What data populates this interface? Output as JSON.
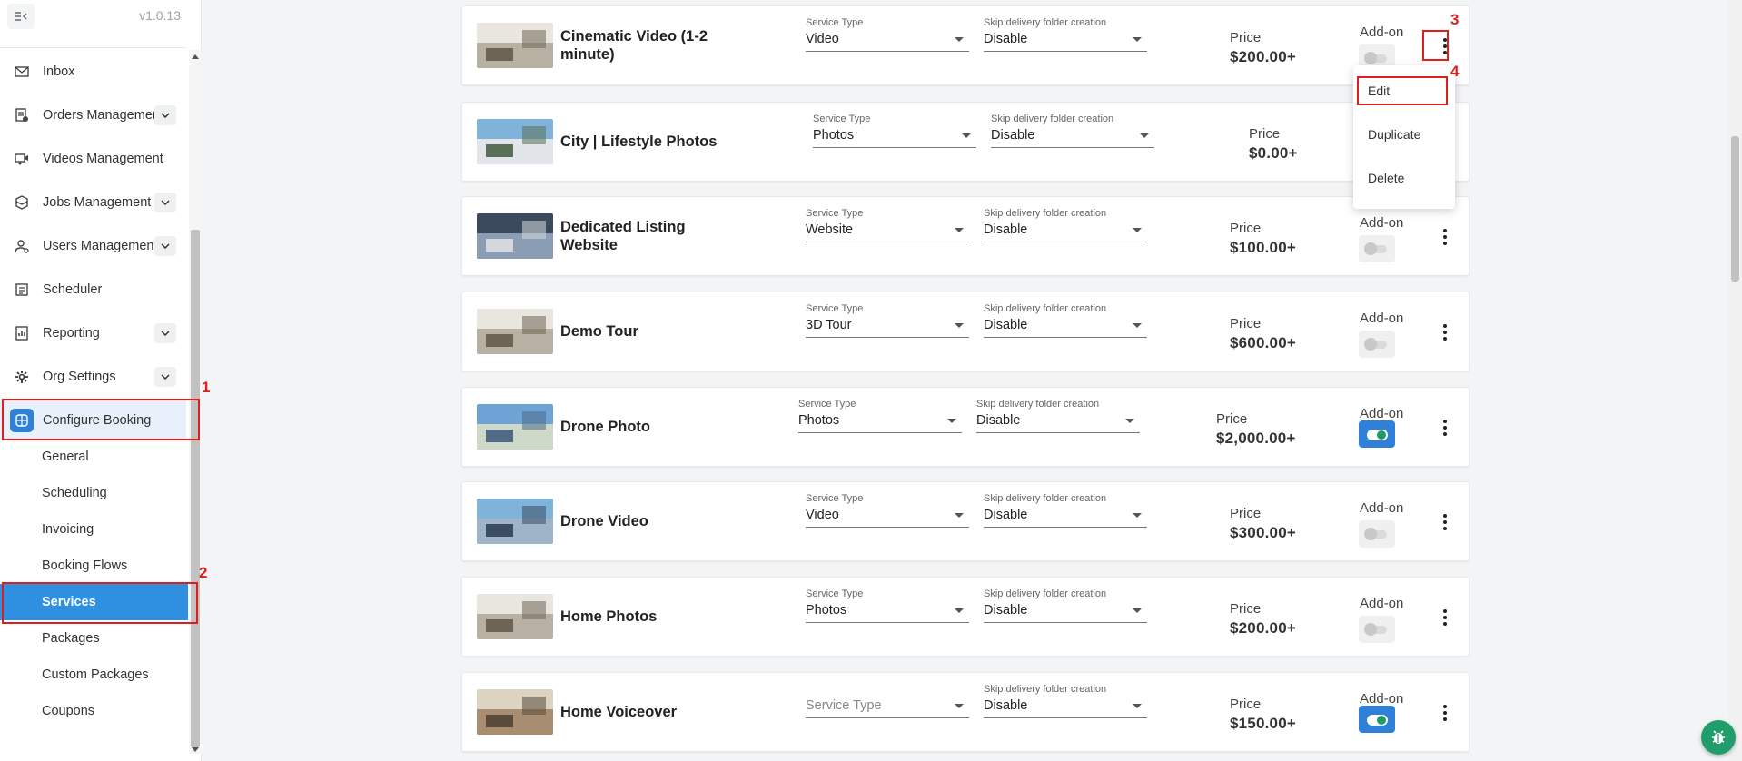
{
  "app": {
    "version": "v1.0.13"
  },
  "sidebar": {
    "items": [
      {
        "label": "Inbox",
        "icon": "mail-icon",
        "has_chevron": false
      },
      {
        "label": "Orders Management",
        "icon": "orders-icon",
        "has_chevron": true
      },
      {
        "label": "Videos Management",
        "icon": "video-icon",
        "has_chevron": false
      },
      {
        "label": "Jobs Management",
        "icon": "box-icon",
        "has_chevron": true
      },
      {
        "label": "Users Management",
        "icon": "users-icon",
        "has_chevron": true
      },
      {
        "label": "Scheduler",
        "icon": "calendar-icon",
        "has_chevron": false
      },
      {
        "label": "Reporting",
        "icon": "report-icon",
        "has_chevron": true
      },
      {
        "label": "Org Settings",
        "icon": "gear-icon",
        "has_chevron": true
      },
      {
        "label": "Configure Booking",
        "icon": "booking-icon",
        "has_chevron": false,
        "active": true
      }
    ],
    "sub_items": [
      "General",
      "Scheduling",
      "Invoicing",
      "Booking Flows",
      "Services",
      "Packages",
      "Custom Packages",
      "Coupons"
    ],
    "active_sub": "Services"
  },
  "labels": {
    "service_type": "Service Type",
    "skip_delivery": "Skip delivery folder creation",
    "price": "Price",
    "addon": "Add-on"
  },
  "services": [
    {
      "name": "Cinematic Video (1-2 minute)",
      "service_type": "Video",
      "skip_delivery": "Disable",
      "price": "$200.00+",
      "addon": false
    },
    {
      "name": "City | Lifestyle Photos",
      "service_type": "Photos",
      "skip_delivery": "Disable",
      "price": "$0.00+",
      "addon": null
    },
    {
      "name": "Dedicated Listing Website",
      "service_type": "Website",
      "skip_delivery": "Disable",
      "price": "$100.00+",
      "addon": false
    },
    {
      "name": "Demo Tour",
      "service_type": "3D Tour",
      "skip_delivery": "Disable",
      "price": "$600.00+",
      "addon": false
    },
    {
      "name": "Drone Photo",
      "service_type": "Photos",
      "skip_delivery": "Disable",
      "price": "$2,000.00+",
      "addon": true
    },
    {
      "name": "Drone Video",
      "service_type": "Video",
      "skip_delivery": "Disable",
      "price": "$300.00+",
      "addon": false
    },
    {
      "name": "Home Photos",
      "service_type": "Photos",
      "skip_delivery": "Disable",
      "price": "$200.00+",
      "addon": false
    },
    {
      "name": "Home Voiceover",
      "service_type": "",
      "service_type_placeholder": "Service Type",
      "skip_delivery": "Disable",
      "price": "$150.00+",
      "addon": true
    }
  ],
  "menu": {
    "items": [
      "Edit",
      "Duplicate",
      "Delete"
    ]
  },
  "markers": [
    "1",
    "2",
    "3",
    "4"
  ],
  "colors": {
    "accent": "#2f80d9",
    "marker": "#e01e1e",
    "toggle_on": "#2f80d9",
    "bug_button": "#1f9d6b"
  }
}
